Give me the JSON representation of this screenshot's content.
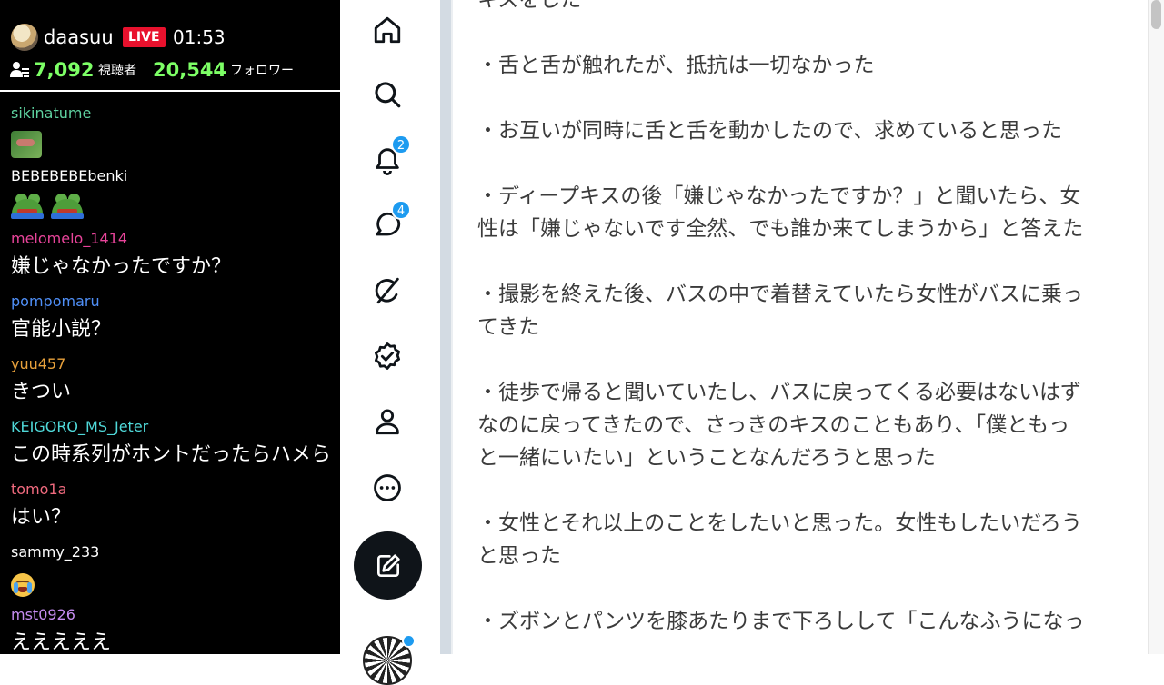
{
  "stream": {
    "streamer": "daasuu",
    "live_label": "LIVE",
    "uptime": "01:53",
    "viewer_count": "7,092",
    "viewer_label": "視聴者",
    "follower_count": "20,544",
    "follower_label": "フォロワー"
  },
  "chat": [
    {
      "user": "sikinatume",
      "color": "#5fd3a1",
      "text": "",
      "emote": "frog-small"
    },
    {
      "user": "BEBEBEBEbenki",
      "color": "#ffffff",
      "text": "",
      "emote": "frog-pair"
    },
    {
      "user": "melomelo_1414",
      "color": "#e8449a",
      "text": "嫌じゃなかったですか？"
    },
    {
      "user": "pompomaru",
      "color": "#4f8ff7",
      "text": "官能小説？"
    },
    {
      "user": "yuu457",
      "color": "#e8a13b",
      "text": "きつい"
    },
    {
      "user": "KEIGORO_MS_Jeter",
      "color": "#4fd8d8",
      "text": "この時系列がホントだったらハメら"
    },
    {
      "user": "tomo1a",
      "color": "#f06a7e",
      "text": "はい？"
    },
    {
      "user": "sammy_233",
      "color": "#ffffff",
      "text": "",
      "emote": "crying-face"
    },
    {
      "user": "mst0926",
      "color": "#c58cf0",
      "text": "えええええ"
    }
  ],
  "nav": {
    "notifications_badge": "2",
    "messages_badge": "4",
    "icons": [
      "home-icon",
      "search-icon",
      "bell-icon",
      "message-icon",
      "grok-icon",
      "verified-icon",
      "profile-icon",
      "more-icon",
      "compose-icon"
    ]
  },
  "article": {
    "paragraphs": [
      "キスをした",
      "・舌と舌が触れたが、抵抗は一切なかった",
      "・お互いが同時に舌と舌を動かしたので、求めていると思った",
      "・ディープキスの後「嫌じゃなかったですか？」と聞いたら、女\n性は「嫌じゃないです全然、でも誰か来てしまうから」と答えた",
      "・撮影を終えた後、バスの中で着替えていたら女性がバスに乗っ\nてきた",
      "・徒歩で帰ると聞いていたし、バスに戻ってくる必要はないはず\nなのに戻ってきたので、さっきのキスのこともあり、「僕ともっ\nと一緒にいたい」ということなんだろうと思った",
      "・女性とそれ以上のことをしたいと思った。女性もしたいだろう\nと思った",
      "・ズボンとパンツを膝あたりまで下ろしして「こんなふうになっ"
    ]
  },
  "colors": {
    "live": "#e8112d",
    "count_green": "#7dff66",
    "badge_blue": "#1d9bf0"
  }
}
